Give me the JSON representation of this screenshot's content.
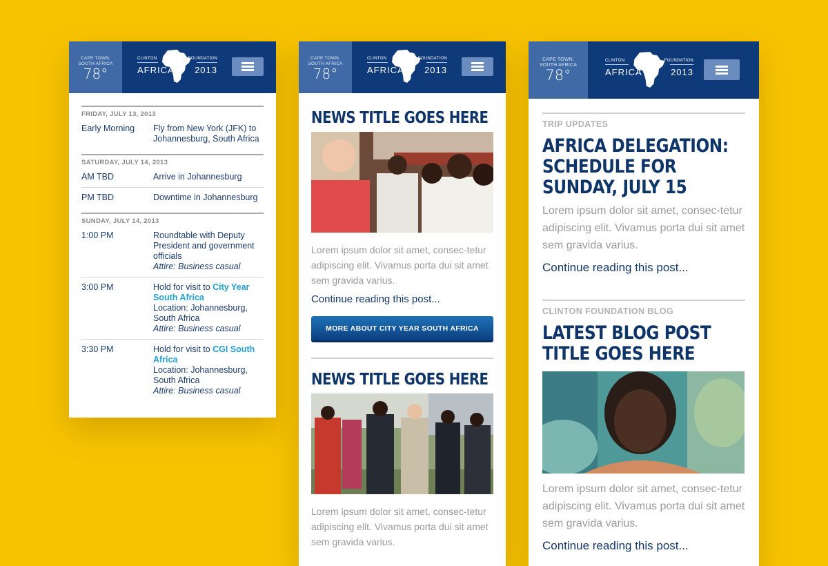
{
  "header": {
    "weather_city_line1": "CAPE TOWN,",
    "weather_city_line2": "SOUTH AFRICA",
    "temperature": "78°",
    "logo_top_left": "CLINTON",
    "logo_top_right": "FOUNDATION",
    "logo_bottom_left": "AFRICA",
    "logo_bottom_right": "2013",
    "menu_icon": "hamburger-menu-icon"
  },
  "schedule": {
    "days": [
      {
        "heading": "FRIDAY, JULY 13, 2013",
        "items": [
          {
            "time": "Early Morning",
            "desc": "Fly from New York (JFK) to Johannesburg, South Africa"
          }
        ]
      },
      {
        "heading": "SATURDAY, JULY 14, 2013",
        "items": [
          {
            "time": "AM TBD",
            "desc": "Arrive in Johannesburg"
          },
          {
            "time": "PM TBD",
            "desc": "Downtime in Johannesburg"
          }
        ]
      },
      {
        "heading": "SUNDAY, JULY 14, 2013",
        "items": [
          {
            "time": "1:00 PM",
            "desc": "Roundtable with Deputy President and government officials",
            "attire": "Attire: Business casual"
          },
          {
            "time": "3:00 PM",
            "desc_prefix": "Hold for visit to ",
            "link": "City Year South Africa",
            "location": "Location: Johannesburg, South Africa",
            "attire": "Attire: Business casual"
          },
          {
            "time": "3:30 PM",
            "desc_prefix": "Hold for visit to ",
            "link": "CGI South Africa",
            "location": "Location: Johannesburg, South Africa",
            "attire": "Attire: Business casual"
          }
        ]
      }
    ]
  },
  "news": {
    "items": [
      {
        "title": "NEWS TITLE GOES HERE",
        "excerpt": "Lorem ipsum dolor sit amet, consec-tetur adipiscing elit. Vivamus porta dui sit amet sem gravida varius.",
        "continue": "Continue reading this post..."
      },
      {
        "title": "NEWS TITLE GOES HERE",
        "excerpt": "Lorem ipsum dolor sit amet, consec-tetur adipiscing elit. Vivamus porta dui sit amet sem gravida varius."
      }
    ],
    "cta": "MORE ABOUT CITY YEAR SOUTH AFRICA"
  },
  "blog": {
    "section1": {
      "kicker": "TRIP UPDATES",
      "title": "AFRICA DELEGATION: SCHEDULE FOR SUNDAY, JULY 15",
      "excerpt": "Lorem ipsum dolor sit amet, consec-tetur adipiscing elit. Vivamus porta dui sit amet sem gravida varius.",
      "continue": "Continue reading this post..."
    },
    "section2": {
      "kicker": "CLINTON FOUNDATION BLOG",
      "title": "LATEST BLOG POST TITLE GOES HERE",
      "excerpt": "Lorem ipsum dolor sit amet, consec-tetur adipiscing elit. Vivamus porta dui sit amet sem gravida varius.",
      "continue": "Continue reading this post..."
    }
  },
  "colors": {
    "background": "#f7c300",
    "header_navy": "#0f3a7a",
    "weather_blue": "#3f6aa6",
    "title_navy": "#0f3468",
    "link_cyan": "#23a0d0"
  }
}
